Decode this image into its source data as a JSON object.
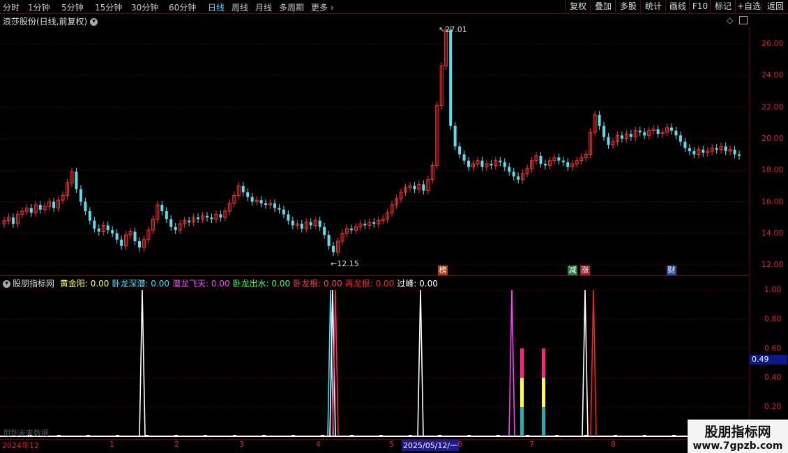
{
  "toolbar": {
    "periods": [
      "分时",
      "1分钟",
      "5分钟",
      "15分钟",
      "30分钟",
      "60分钟",
      "日线",
      "周线",
      "月线",
      "多周期",
      "更多"
    ],
    "active_period": "日线",
    "right_buttons": [
      "复权",
      "叠加",
      "多股",
      "统计",
      "画线",
      "F10",
      "标记",
      "+自选",
      "返回"
    ]
  },
  "main_chart": {
    "title": "浪莎股份(日线,前复权)",
    "price_labels": [
      "26.00",
      "24.00",
      "22.00",
      "20.00",
      "18.00",
      "16.00",
      "14.00",
      "12.00"
    ],
    "high_annotation": "27.01",
    "low_annotation": "12.15",
    "event_markers": [
      "榜",
      "减",
      "涨",
      "财"
    ],
    "colors": {
      "up": "#ff3030",
      "down": "#54e0ee",
      "grid": "#7a0000"
    }
  },
  "indicator": {
    "legend_name": "股朋指标网",
    "items": [
      {
        "label": "黄金阳:",
        "value": "0.00",
        "color": "#ffff40"
      },
      {
        "label": "卧龙深潜:",
        "value": "0.00",
        "color": "#40e0ff"
      },
      {
        "label": "潜龙飞天:",
        "value": "0.00",
        "color": "#ff40ff"
      },
      {
        "label": "卧龙出水:",
        "value": "0.00",
        "color": "#40ff40"
      },
      {
        "label": "卧龙根:",
        "value": "0.00",
        "color": "#ff4040"
      },
      {
        "label": "再龙根:",
        "value": "0.00",
        "color": "#ff2020"
      },
      {
        "label": "过峰:",
        "value": "0.00",
        "color": "#ffffff"
      }
    ],
    "axis_labels": [
      "1.00",
      "0.80",
      "0.60",
      "0.40",
      "0.20"
    ],
    "current_value": "0.49",
    "footer_note": "用到未来数据"
  },
  "bottom_axis": {
    "labels": [
      "2024年12",
      "1",
      "2",
      "3",
      "4",
      "5",
      "6",
      "7",
      "8"
    ],
    "cursor_date": "2025/05/12/一"
  },
  "watermark": {
    "title": "股朋指标网",
    "url": "www.7gpzb.com"
  }
}
